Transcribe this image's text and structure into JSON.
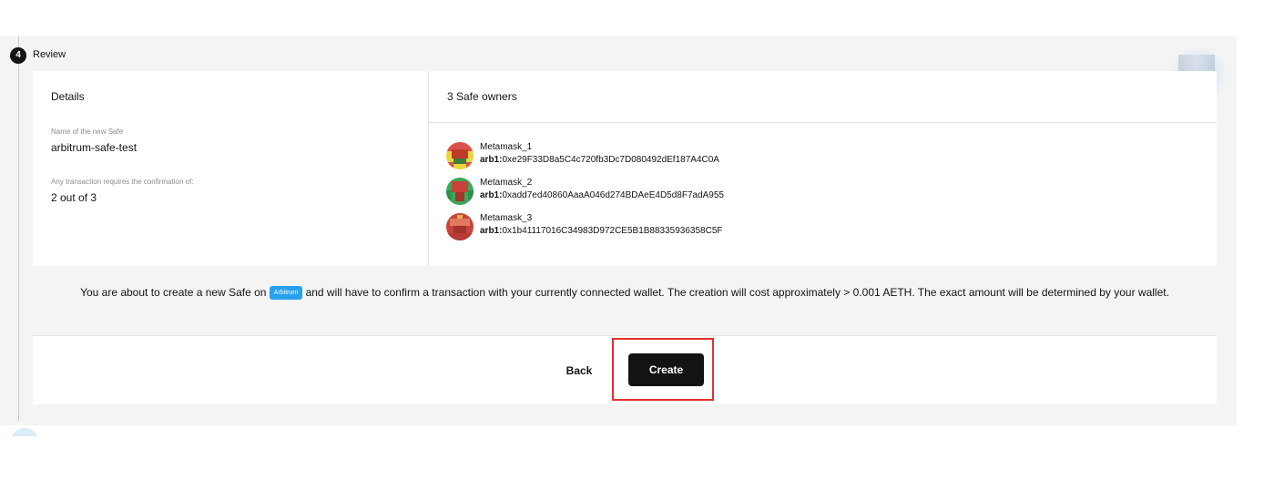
{
  "step": {
    "number": "4",
    "title": "Review"
  },
  "details": {
    "heading": "Details",
    "name_label": "Name of the new Safe",
    "name_value": "arbitrum-safe-test",
    "threshold_label": "Any transaction requires the confirmation of:",
    "threshold_value": "2 out of 3"
  },
  "owners": {
    "heading": "3 Safe owners",
    "items": [
      {
        "name": "Metamask_1",
        "prefix": "arb1:",
        "address": "0xe29F33D8a5C4c720fb3Dc7D080492dEf187A4C0A"
      },
      {
        "name": "Metamask_2",
        "prefix": "arb1:",
        "address": "0xadd7ed40860AaaA046d274BDAeE4D5d8F7adA955"
      },
      {
        "name": "Metamask_3",
        "prefix": "arb1:",
        "address": "0x1b41117016C34983D972CE5B1B88335936358C5F"
      }
    ]
  },
  "info": {
    "before_chip": "You are about to create a new Safe on",
    "chain": "Arbitrum",
    "after_chip": "and will have to confirm a transaction with your currently connected wallet. The creation will cost approximately > 0.001 AETH. The exact amount will be determined by your wallet."
  },
  "actions": {
    "back_label": "Back",
    "create_label": "Create"
  },
  "colors": {
    "panel_bg": "#f4f4f4",
    "card_bg": "#ffffff",
    "primary_btn": "#121312",
    "chain_chip": "#28a0f0",
    "highlight": "#e0322b"
  }
}
